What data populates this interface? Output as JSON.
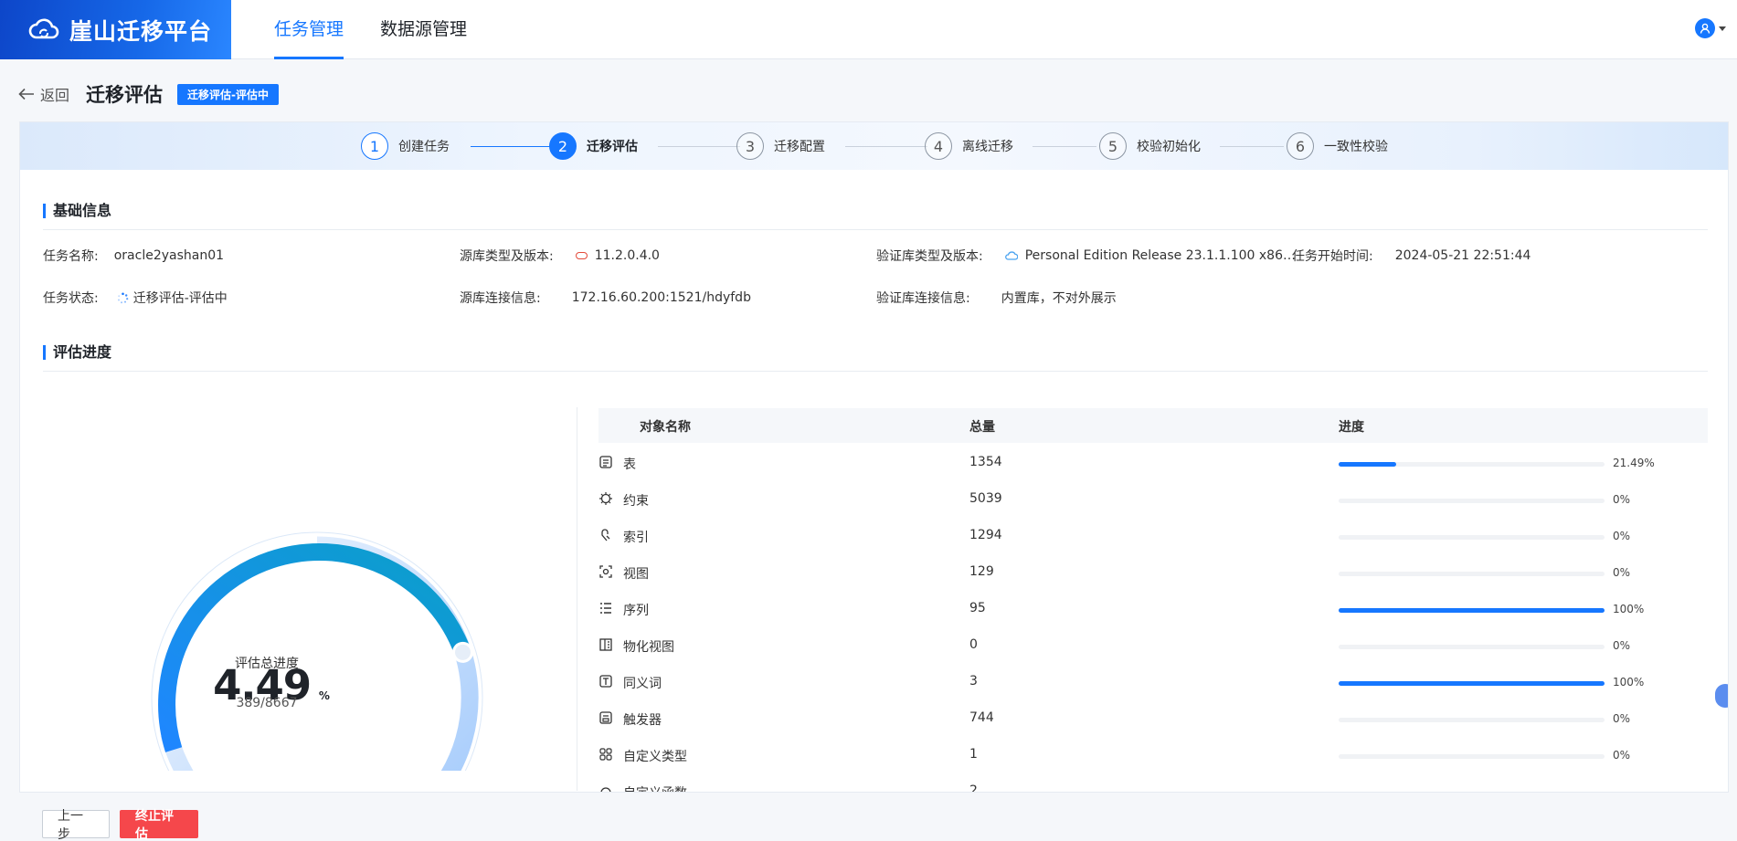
{
  "app": {
    "name": "崖山迁移平台",
    "logo_icon": "cloud-sync-icon"
  },
  "nav": {
    "items": [
      {
        "label": "任务管理",
        "active": true
      },
      {
        "label": "数据源管理",
        "active": false
      }
    ]
  },
  "user": {
    "icon": "user-icon"
  },
  "page": {
    "back_label": "返回",
    "title": "迁移评估",
    "badge": "迁移评估-评估中"
  },
  "steps": [
    {
      "num": "1",
      "label": "创建任务",
      "state": "done"
    },
    {
      "num": "2",
      "label": "迁移评估",
      "state": "active"
    },
    {
      "num": "3",
      "label": "迁移配置",
      "state": "todo"
    },
    {
      "num": "4",
      "label": "离线迁移",
      "state": "todo"
    },
    {
      "num": "5",
      "label": "校验初始化",
      "state": "todo"
    },
    {
      "num": "6",
      "label": "一致性校验",
      "state": "todo"
    }
  ],
  "basic": {
    "title": "基础信息",
    "task_name_k": "任务名称:",
    "task_name_v": "oracle2yashan01",
    "src_type_k": "源库类型及版本:",
    "src_type_v": "11.2.0.4.0",
    "src_icon": "oracle-icon",
    "ver_type_k": "验证库类型及版本:",
    "ver_type_v": "Personal Edition Release 23.1.1.100 x86…",
    "ver_icon": "yashan-icon",
    "start_time_k": "任务开始时间:",
    "start_time_v": "2024-05-21 22:51:44",
    "status_k": "任务状态:",
    "status_v": "迁移评估-评估中",
    "status_icon": "loading-icon",
    "src_conn_k": "源库连接信息:",
    "src_conn_v": "172.16.60.200:1521/hdyfdb",
    "ver_conn_k": "验证库连接信息:",
    "ver_conn_v": "内置库，不对外展示"
  },
  "progress": {
    "title": "评估进度",
    "percent": "4.49",
    "percent_unit": "%",
    "percent_value": 4.49,
    "label": "评估总进度",
    "ratio": "389/8667"
  },
  "table": {
    "headers": {
      "name": "对象名称",
      "total": "总量",
      "progress": "进度"
    },
    "rows": [
      {
        "icon": "table-icon",
        "name": "表",
        "total": "1354",
        "pct": "21.49%",
        "value": 21.49
      },
      {
        "icon": "constraint-icon",
        "name": "约束",
        "total": "5039",
        "pct": "0%",
        "value": 0
      },
      {
        "icon": "index-icon",
        "name": "索引",
        "total": "1294",
        "pct": "0%",
        "value": 0
      },
      {
        "icon": "view-icon",
        "name": "视图",
        "total": "129",
        "pct": "0%",
        "value": 0
      },
      {
        "icon": "sequence-icon",
        "name": "序列",
        "total": "95",
        "pct": "100%",
        "value": 100
      },
      {
        "icon": "materialized-view-icon",
        "name": "物化视图",
        "total": "0",
        "pct": "0%",
        "value": 0
      },
      {
        "icon": "synonym-icon",
        "name": "同义词",
        "total": "3",
        "pct": "100%",
        "value": 100
      },
      {
        "icon": "trigger-icon",
        "name": "触发器",
        "total": "744",
        "pct": "0%",
        "value": 0
      },
      {
        "icon": "custom-type-icon",
        "name": "自定义类型",
        "total": "1",
        "pct": "0%",
        "value": 0
      },
      {
        "icon": "function-icon",
        "name": "自定义函数",
        "total": "2",
        "pct": "",
        "value": 0
      }
    ]
  },
  "buttons": {
    "prev": "上一步",
    "stop": "终止评估"
  },
  "colors": {
    "primary": "#1677ff",
    "danger": "#f5474b"
  }
}
